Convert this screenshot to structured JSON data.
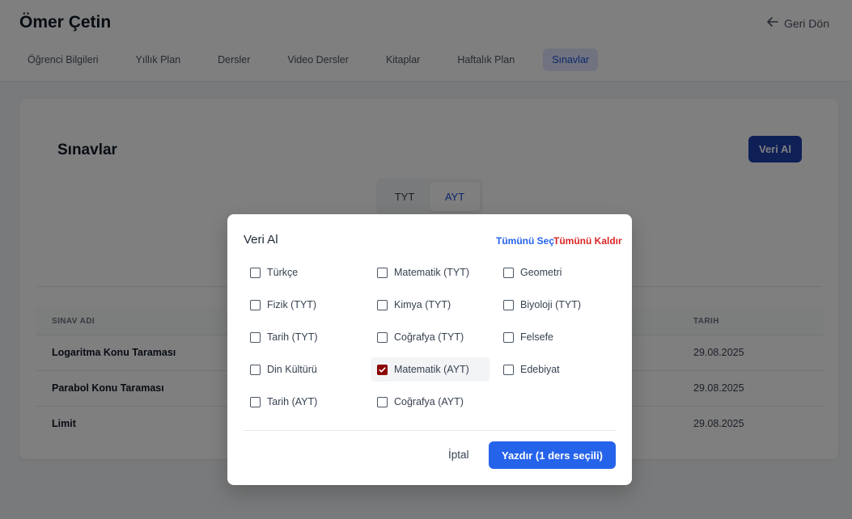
{
  "header": {
    "student_name": "Ömer Çetin",
    "back_label": "Geri Dön",
    "tabs": [
      {
        "label": "Öğrenci Bilgileri"
      },
      {
        "label": "Yıllık Plan"
      },
      {
        "label": "Dersler"
      },
      {
        "label": "Video Dersler"
      },
      {
        "label": "Kitaplar"
      },
      {
        "label": "Haftalık Plan"
      },
      {
        "label": "Sınavlar",
        "active": true
      }
    ]
  },
  "main": {
    "title": "Sınavlar",
    "fetch_button": "Veri Al",
    "segments": [
      "TYT",
      "AYT"
    ],
    "active_segment": "AYT",
    "table": {
      "columns": [
        "SINAV ADI",
        "TARIH"
      ],
      "rows": [
        {
          "name": "Logaritma Konu Taraması",
          "date": "29.08.2025"
        },
        {
          "name": "Parabol Konu Taraması",
          "date": "29.08.2025"
        },
        {
          "name": "Limit",
          "date": "29.08.2025"
        }
      ]
    }
  },
  "modal": {
    "title": "Veri Al",
    "select_all": "Tümünü Seç",
    "clear_all": "Tümünü Kaldır",
    "options": [
      {
        "label": "Türkçe",
        "checked": false
      },
      {
        "label": "Matematik (TYT)",
        "checked": false
      },
      {
        "label": "Geometri",
        "checked": false
      },
      {
        "label": "Fizik (TYT)",
        "checked": false
      },
      {
        "label": "Kimya (TYT)",
        "checked": false
      },
      {
        "label": "Biyoloji (TYT)",
        "checked": false
      },
      {
        "label": "Tarih (TYT)",
        "checked": false
      },
      {
        "label": "Coğrafya (TYT)",
        "checked": false
      },
      {
        "label": "Felsefe",
        "checked": false
      },
      {
        "label": "Din Kültürü",
        "checked": false
      },
      {
        "label": "Matematik (AYT)",
        "checked": true
      },
      {
        "label": "Edebiyat",
        "checked": false
      },
      {
        "label": "Tarih (AYT)",
        "checked": false
      },
      {
        "label": "Coğrafya (AYT)",
        "checked": false
      }
    ],
    "cancel_label": "İptal",
    "print_label": "Yazdır (1 ders seçili)"
  },
  "colors": {
    "primary": "#2563eb",
    "primary_dark": "#1e40af",
    "danger": "#dc2626",
    "checkbox_checked": "#8b0000"
  }
}
